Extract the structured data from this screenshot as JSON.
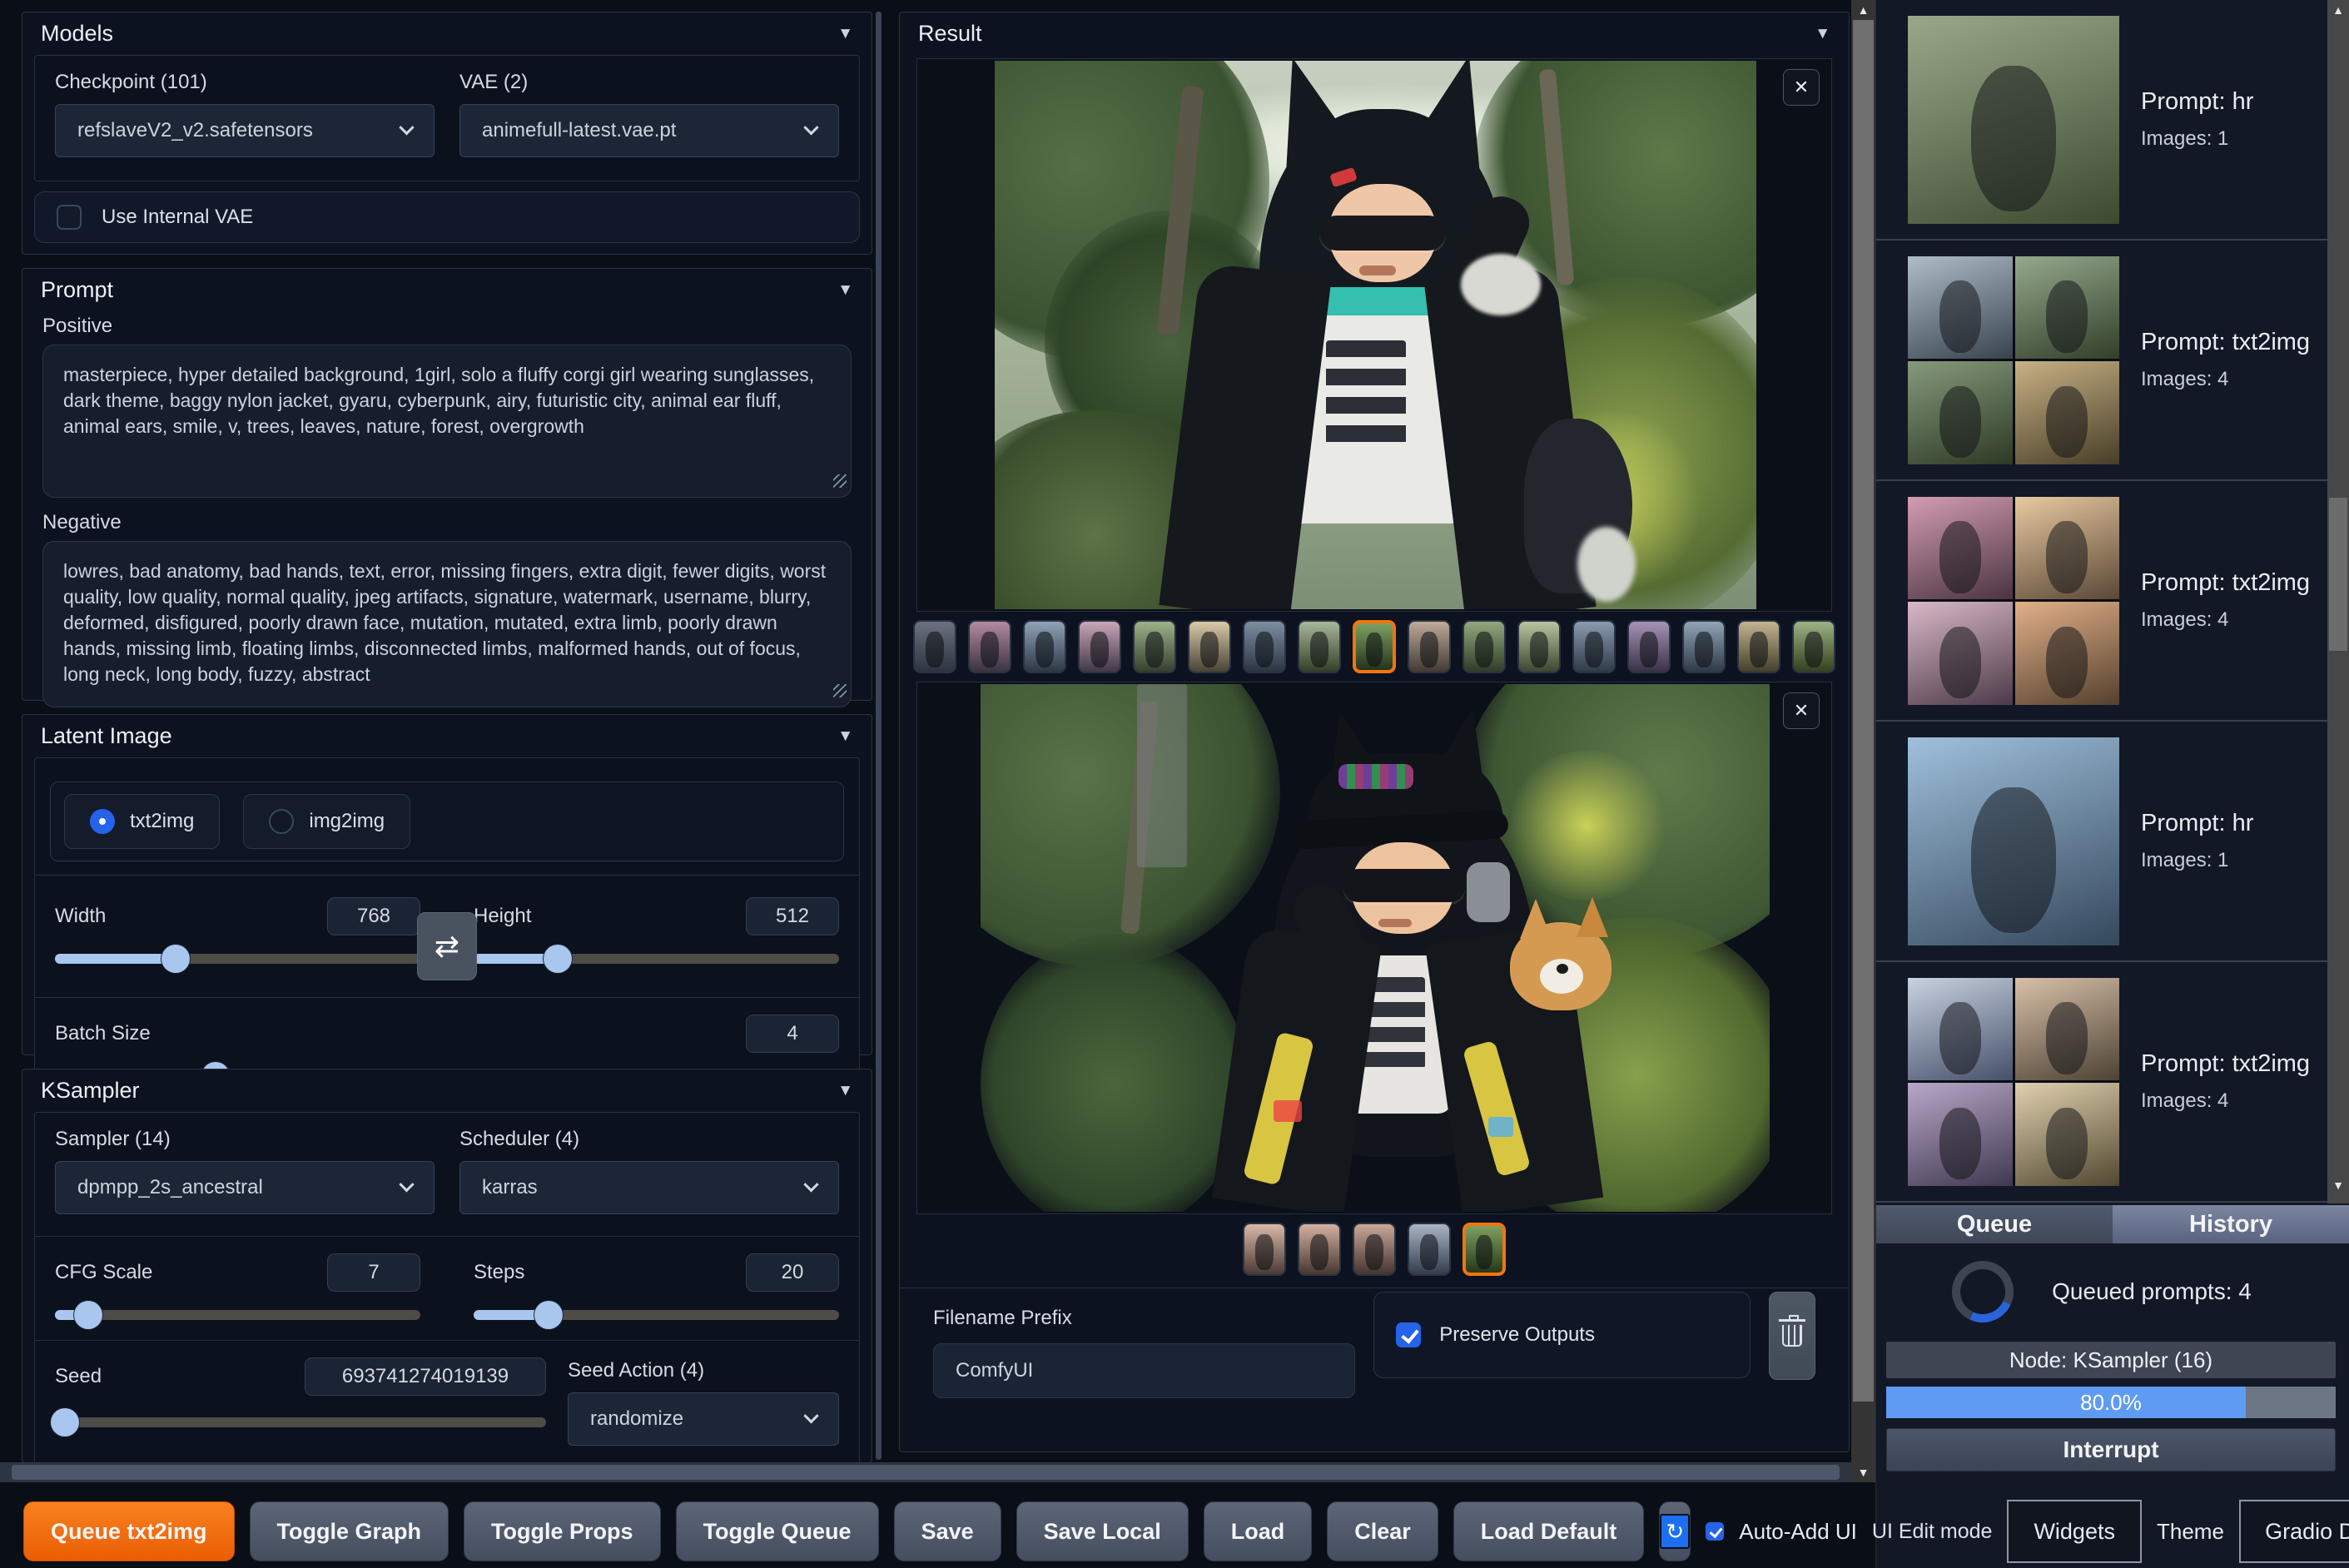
{
  "models": {
    "title": "Models",
    "checkpoint_label": "Checkpoint (101)",
    "checkpoint_value": "refslaveV2_v2.safetensors",
    "vae_label": "VAE (2)",
    "vae_value": "animefull-latest.vae.pt",
    "use_internal_vae_label": "Use Internal VAE",
    "use_internal_vae_checked": false
  },
  "prompt": {
    "title": "Prompt",
    "positive_label": "Positive",
    "positive_value": "masterpiece, hyper detailed background, 1girl, solo a fluffy corgi girl wearing sunglasses, dark theme, baggy nylon jacket, gyaru, cyberpunk, airy, futuristic city, animal ear fluff, animal ears, smile, v, trees, leaves, nature, forest, overgrowth",
    "negative_label": "Negative",
    "negative_value": "lowres, bad anatomy, bad hands, text, error, missing fingers, extra digit, fewer digits, worst quality, low quality, normal quality, jpeg artifacts, signature, watermark, username, blurry, deformed, disfigured, poorly drawn face, mutation, mutated, extra limb, poorly drawn hands, missing limb, floating limbs, disconnected limbs, malformed hands, out of focus, long neck, long body, fuzzy, abstract"
  },
  "latent": {
    "title": "Latent Image",
    "mode_txt2img": "txt2img",
    "mode_img2img": "img2img",
    "width_label": "Width",
    "width_value": "768",
    "width_pos": 0.33,
    "height_label": "Height",
    "height_value": "512",
    "height_pos": 0.23,
    "batch_label": "Batch Size",
    "batch_value": "4",
    "batch_pos": 0.205
  },
  "ksampler": {
    "title": "KSampler",
    "sampler_label": "Sampler (14)",
    "sampler_value": "dpmpp_2s_ancestral",
    "scheduler_label": "Scheduler (4)",
    "scheduler_value": "karras",
    "cfg_label": "CFG Scale",
    "cfg_value": "7",
    "cfg_pos": 0.09,
    "steps_label": "Steps",
    "steps_value": "20",
    "steps_pos": 0.205,
    "seed_label": "Seed",
    "seed_value": "693741274019139",
    "seed_pos": 0.02,
    "seed_action_label": "Seed Action (4)",
    "seed_action_value": "randomize"
  },
  "result": {
    "title": "Result",
    "close_label": "✕",
    "gallery1": {
      "selected": 8,
      "thumbs": [
        [
          "#6b7280",
          "#2d3440"
        ],
        [
          "#b48aa0",
          "#3a3342"
        ],
        [
          "#8fa3b8",
          "#2e3644"
        ],
        [
          "#c9a6b8",
          "#403848"
        ],
        [
          "#9db28a",
          "#35402e"
        ],
        [
          "#d9c9a8",
          "#4a4336"
        ],
        [
          "#7d8ea3",
          "#2c3442"
        ],
        [
          "#a8b89a",
          "#334028"
        ],
        [
          "#7da063",
          "#24331c"
        ],
        [
          "#c0aa9a",
          "#433a34"
        ],
        [
          "#93a87e",
          "#2f3c26"
        ],
        [
          "#b8c4a0",
          "#3d4630"
        ],
        [
          "#8a9bb0",
          "#303a48"
        ],
        [
          "#a693b5",
          "#3a3148"
        ],
        [
          "#90a4b6",
          "#2f3947"
        ],
        [
          "#c4b490",
          "#44402c"
        ],
        [
          "#9eb284",
          "#33401f"
        ]
      ]
    },
    "gallery2": {
      "selected": 4,
      "thumbs": [
        [
          "#d8b9a8",
          "#4a3a34"
        ],
        [
          "#d4b0a0",
          "#483830"
        ],
        [
          "#c8a898",
          "#443430"
        ],
        [
          "#aab4c4",
          "#343c4c"
        ],
        [
          "#7fa05f",
          "#273818"
        ]
      ]
    },
    "filename_label": "Filename Prefix",
    "filename_value": "ComfyUI",
    "preserve_label": "Preserve Outputs",
    "preserve_checked": true
  },
  "sidebar": {
    "items": [
      {
        "prompt": "Prompt: hr",
        "images": "Images: 1",
        "cells": [
          [
            "#9aa88a",
            "#3c4a30"
          ]
        ]
      },
      {
        "prompt": "Prompt: txt2img",
        "images": "Images: 4",
        "cells": [
          [
            "#aebdc8",
            "#39434e"
          ],
          [
            "#95a88c",
            "#323f2a"
          ],
          [
            "#87997b",
            "#2d3a26"
          ],
          [
            "#c8b184",
            "#473e28"
          ]
        ]
      },
      {
        "prompt": "Prompt: txt2img",
        "images": "Images: 4",
        "cells": [
          [
            "#d39db0",
            "#4a3442"
          ],
          [
            "#e8c9a0",
            "#5a4836"
          ],
          [
            "#d9b8c8",
            "#4c3a48"
          ],
          [
            "#e2b088",
            "#54402e"
          ]
        ]
      },
      {
        "prompt": "Prompt: hr",
        "images": "Images: 1",
        "cells": [
          [
            "#9fc0dc",
            "#35485c"
          ]
        ]
      },
      {
        "prompt": "Prompt: txt2img",
        "images": "Images: 4",
        "cells": [
          [
            "#c8d2e0",
            "#47506a"
          ],
          [
            "#d8c0a8",
            "#4c4234"
          ],
          [
            "#b8a8c8",
            "#403850"
          ],
          [
            "#e0d0b0",
            "#524830"
          ]
        ]
      }
    ],
    "tabs": [
      "Queue",
      "History"
    ],
    "queued_text": "Queued prompts: 4",
    "node_text": "Node: KSampler (16)",
    "progress": 0.8,
    "progress_text": "80.0%",
    "interrupt_label": "Interrupt"
  },
  "toolbar": {
    "buttons": [
      {
        "label": "Queue txt2img",
        "accent": true
      },
      {
        "label": "Toggle Graph"
      },
      {
        "label": "Toggle Props"
      },
      {
        "label": "Toggle Queue"
      },
      {
        "label": "Save"
      },
      {
        "label": "Save Local"
      },
      {
        "label": "Load"
      },
      {
        "label": "Clear"
      },
      {
        "label": "Load Default"
      }
    ],
    "refresh_icon": "↻",
    "auto_add_label": "Auto-Add UI",
    "auto_add_checked": true,
    "ui_edit_label": "UI Edit mode",
    "widgets_value": "Widgets",
    "theme_label": "Theme",
    "theme_value": "Gradio Dark"
  },
  "colors": {
    "accent_orange": "#f0750f",
    "accent_blue": "#2563eb",
    "slider_blue": "#a9c6ef",
    "progress_blue": "#5f9bf2",
    "page_bg": "#0a0e17",
    "panel_bg": "#0d1220"
  }
}
